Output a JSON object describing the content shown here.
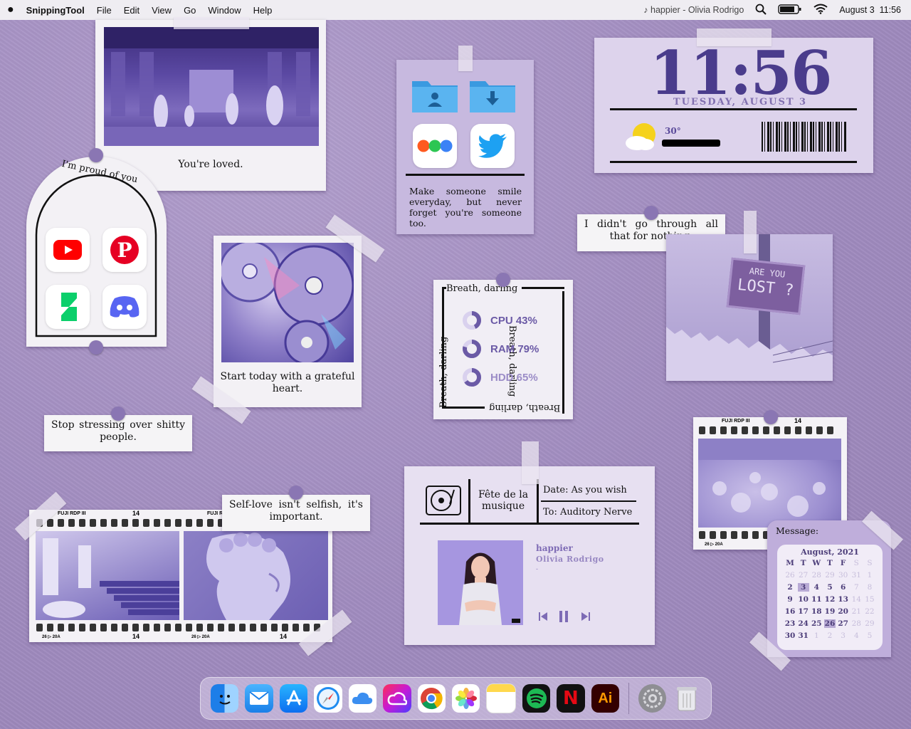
{
  "menubar": {
    "app_name": "SnippingTool",
    "menus": [
      "File",
      "Edit",
      "View",
      "Go",
      "Window",
      "Help"
    ],
    "now_playing": "♪ happier - Olivia Rodrigo",
    "date": "August 3",
    "time": "11:56"
  },
  "polaroid_gallery": {
    "caption": "You're loved."
  },
  "arch_widget": {
    "label": "I'm proud of you",
    "apps": [
      "youtube-icon",
      "pinterest-icon",
      "deviantart-icon",
      "discord-icon"
    ]
  },
  "folder_widget": {
    "quote": "Make someone smile everyday, but never forget you're someone too.",
    "icons": [
      "user-folder-icon",
      "downloads-folder-icon",
      "color-dots-app-icon",
      "twitter-icon"
    ]
  },
  "clock_widget": {
    "time": "11:56",
    "date": "TUESDAY, AUGUST 3",
    "temperature": "30°"
  },
  "polaroid_cd": {
    "caption": "Start today with a grateful heart."
  },
  "note_stop": {
    "text": "Stop stressing over shitty people."
  },
  "note_didnt": {
    "text": "I didn't go through all that for nothing."
  },
  "lost_sign": {
    "line1": "ARE YOU",
    "line2": "LOST ?"
  },
  "system_stats": {
    "frame_label": "Breath, darling",
    "stats": [
      {
        "label": "CPU 43%",
        "value": 43
      },
      {
        "label": "RAM 79%",
        "value": 79
      },
      {
        "label": "HDD 65%",
        "value": 65
      }
    ]
  },
  "note_selflove": {
    "text": "Self-love isn't selfish, it's important."
  },
  "film_strip": {
    "brand": "FUJI RDP III",
    "frame_num": "14",
    "frame_code": "20A",
    "arrow_prefix": "26"
  },
  "film_single": {
    "brand": "FUJI RDP III",
    "frame_num": "14",
    "frame_code": "20A",
    "arrow_prefix": "26"
  },
  "music_widget": {
    "title_block": "Fête de la musique",
    "date_line": "Date: As you wish",
    "to_line": "To: Auditory Nerve",
    "song": "happier",
    "artist": "Olivia Rodrigo",
    "progress": "-"
  },
  "calendar": {
    "message_label": "Message:",
    "month": "August, 2021",
    "weekdays": [
      "M",
      "T",
      "W",
      "T",
      "F",
      "S",
      "S"
    ],
    "weeks": [
      [
        "26",
        "27",
        "28",
        "29",
        "30",
        "31",
        "1"
      ],
      [
        "2",
        "3",
        "4",
        "5",
        "6",
        "7",
        "8"
      ],
      [
        "9",
        "10",
        "11",
        "12",
        "13",
        "14",
        "15"
      ],
      [
        "16",
        "17",
        "18",
        "19",
        "20",
        "21",
        "22"
      ],
      [
        "23",
        "24",
        "25",
        "26",
        "27",
        "28",
        "29"
      ],
      [
        "30",
        "31",
        "1",
        "2",
        "3",
        "4",
        "5"
      ]
    ]
  },
  "dock": {
    "apps": [
      "finder-icon",
      "mail-icon",
      "app-store-icon",
      "safari-icon",
      "icloud-icon",
      "creative-cloud-icon",
      "chrome-icon",
      "photos-icon",
      "notes-icon",
      "spotify-icon",
      "netflix-icon",
      "illustrator-icon",
      "system-preferences-icon",
      "trash-icon"
    ],
    "netflix_letter": "N",
    "illustrator_letters": "Ai"
  },
  "colors": {
    "accent": "#5a4a9a",
    "background": "#a792c4",
    "pin": "#8a76b3"
  }
}
